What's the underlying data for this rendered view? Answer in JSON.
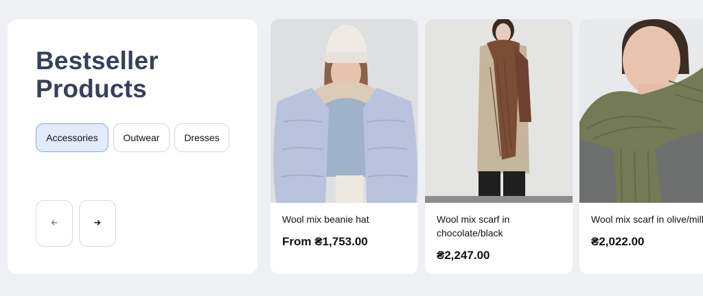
{
  "section": {
    "title_line1": "Bestseller",
    "title_line2": "Products"
  },
  "tabs": [
    {
      "label": "Accessories",
      "active": true
    },
    {
      "label": "Outwear",
      "active": false
    },
    {
      "label": "Dresses",
      "active": false
    }
  ],
  "nav": {
    "prev_icon": "arrow-left-icon",
    "next_icon": "arrow-right-icon"
  },
  "products": [
    {
      "name": "Wool mix beanie hat",
      "price": "From ₴1,753.00"
    },
    {
      "name": "Wool mix scarf in chocolate/black",
      "price": "₴2,247.00"
    },
    {
      "name": "Wool mix scarf in olive/milk",
      "price": "₴2,022.00"
    }
  ],
  "colors": {
    "page_bg": "#eef0f3",
    "title": "#36405a",
    "active_tab_bg": "#e2ebfa",
    "active_tab_border": "#8da6d4"
  }
}
